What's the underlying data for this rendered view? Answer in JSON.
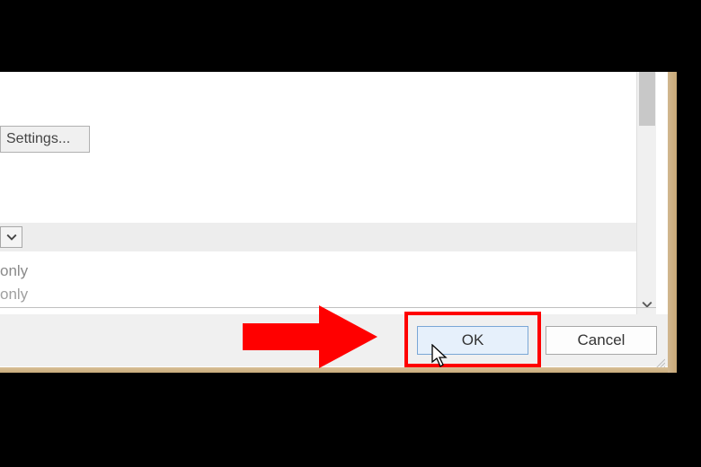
{
  "buttons": {
    "settings_label": "Settings...",
    "ok_label": "OK",
    "cancel_label": "Cancel"
  },
  "list_text": {
    "line1": "only",
    "line2": "only"
  },
  "annotation": {
    "highlight_color": "#ff0000"
  }
}
